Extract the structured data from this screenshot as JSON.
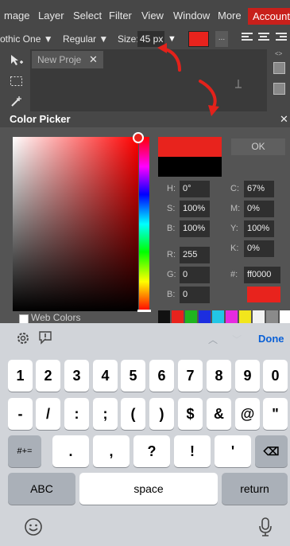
{
  "menu": {
    "items": [
      "mage",
      "Layer",
      "Select",
      "Filter",
      "View",
      "Window",
      "More"
    ],
    "account": "Account"
  },
  "toolbar": {
    "font_family": "othic One ▼",
    "font_style": "Regular ▼",
    "size_label": "Size:",
    "size_value": "45 px",
    "size_dropdown_arrow": "▼",
    "dots_label": "...",
    "swatch_color": "#e8231d"
  },
  "workspace": {
    "tab_title": "New Proje",
    "tab_close": "✕",
    "panel_toggle": "<>"
  },
  "color_picker": {
    "title": "Color Picker",
    "close": "✕",
    "ok": "OK",
    "web_colors": "Web Colors",
    "current_color": "#e8231d",
    "fields": {
      "h_label": "H:",
      "h_value": "0°",
      "s_label": "S:",
      "s_value": "100%",
      "b_label": "B:",
      "b_value": "100%",
      "r_label": "R:",
      "r_value": "255",
      "g_label": "G:",
      "g_value": "0",
      "bl_label": "B:",
      "bl_value": "0",
      "c_label": "C:",
      "c_value": "67%",
      "m_label": "M:",
      "m_value": "0%",
      "y_label": "Y:",
      "y_value": "100%",
      "k_label": "K:",
      "k_value": "0%",
      "hex_label": "#:",
      "hex_value": "ff0000"
    },
    "palette": [
      "#111111",
      "#e8231d",
      "#1fb51f",
      "#1c2ee0",
      "#22c6e6",
      "#e62ae0",
      "#f2e61c",
      "#f2f2f2",
      "#8a8a8a",
      "#ffffff"
    ]
  },
  "accessory": {
    "done": "Done",
    "up": "︿",
    "down": "﹀"
  },
  "keyboard": {
    "row1": [
      "1",
      "2",
      "3",
      "4",
      "5",
      "6",
      "7",
      "8",
      "9",
      "0"
    ],
    "row2": [
      "-",
      "/",
      ":",
      ";",
      "(",
      ")",
      "$",
      "&",
      "@",
      "\""
    ],
    "shift": "#+=",
    "row3": [
      ".",
      ",",
      "?",
      "!",
      "'"
    ],
    "backspace": "⌫",
    "abc": "ABC",
    "space": "space",
    "return": "return",
    "emoji": "☺",
    "mic": "🎙"
  }
}
